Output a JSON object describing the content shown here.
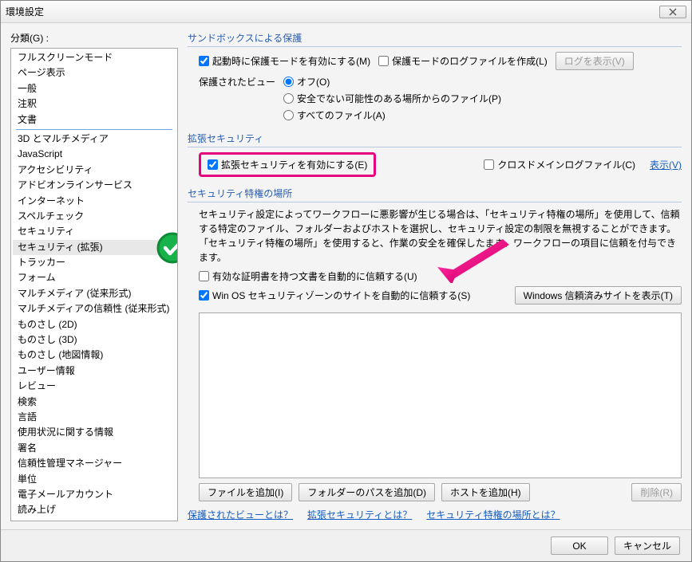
{
  "window": {
    "title": "環境設定"
  },
  "sidebar": {
    "label": "分類(G) :",
    "group1": [
      "フルスクリーンモード",
      "ページ表示",
      "一般",
      "注釈",
      "文書"
    ],
    "group2": [
      "3D とマルチメディア",
      "JavaScript",
      "アクセシビリティ",
      "アドビオンラインサービス",
      "インターネット",
      "スペルチェック",
      "セキュリティ",
      "セキュリティ (拡張)",
      "トラッカー",
      "フォーム",
      "マルチメディア (従来形式)",
      "マルチメディアの信頼性 (従来形式)",
      "ものさし (2D)",
      "ものさし (3D)",
      "ものさし (地図情報)",
      "ユーザー情報",
      "レビュー",
      "検索",
      "言語",
      "使用状況に関する情報",
      "署名",
      "信頼性管理マネージャー",
      "単位",
      "電子メールアカウント",
      "読み上げ"
    ],
    "selectedIndex": 7
  },
  "sandbox": {
    "title": "サンドボックスによる保護",
    "enableOnStartup": "起動時に保護モードを有効にする(M)",
    "createLog": "保護モードのログファイルを作成(L)",
    "showLogBtn": "ログを表示(V)",
    "protectedViewLabel": "保護されたビュー",
    "radios": {
      "off": "オフ(O)",
      "unsafe": "安全でない可能性のある場所からのファイル(P)",
      "all": "すべてのファイル(A)"
    }
  },
  "enhanced": {
    "title": "拡張セキュリティ",
    "enable": "拡張セキュリティを有効にする(E)",
    "crossDomain": "クロスドメインログファイル(C)",
    "showLink": "表示(V)"
  },
  "privileged": {
    "title": "セキュリティ特権の場所",
    "desc": "セキュリティ設定によってワークフローに悪影響が生じる場合は、「セキュリティ特権の場所」を使用して、信頼する特定のファイル、フォルダーおよびホストを選択し、セキュリティ設定の制限を無視することができます。「セキュリティ特権の場所」を使用すると、作業の安全を確保したまま、ワークフローの項目に信頼を付与できます。",
    "trustCertDocs": "有効な証明書を持つ文書を自動的に信頼する(U)",
    "trustWinOS": "Win OS セキュリティゾーンのサイトを自動的に信頼する(S)",
    "showWinSitesBtn": "Windows 信頼済みサイトを表示(T)",
    "addFile": "ファイルを追加(I)",
    "addFolder": "フォルダーのパスを追加(D)",
    "addHost": "ホストを追加(H)",
    "remove": "削除(R)"
  },
  "helpLinks": {
    "protectedView": "保護されたビューとは？",
    "enhancedSec": "拡張セキュリティとは？",
    "privLoc": "セキュリティ特権の場所とは？"
  },
  "footer": {
    "ok": "OK",
    "cancel": "キャンセル"
  }
}
